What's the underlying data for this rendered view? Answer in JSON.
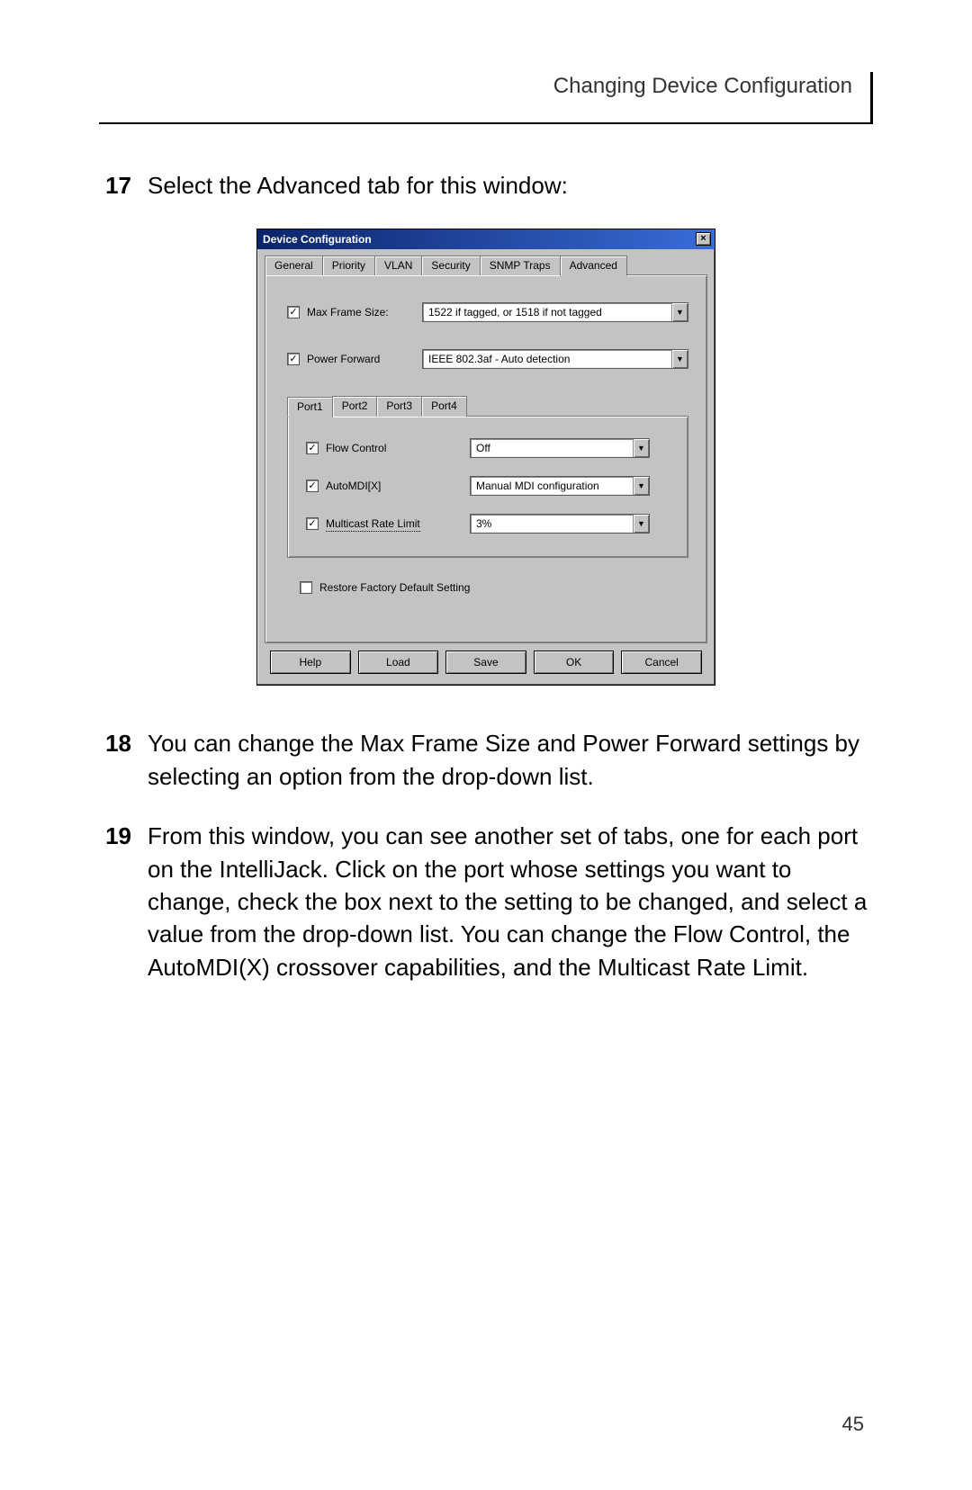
{
  "header": {
    "running_title": "Changing Device Configuration"
  },
  "steps": [
    {
      "num": "17",
      "text": "Select the Advanced tab for this window:"
    },
    {
      "num": "18",
      "text": "You can change the Max Frame Size and Power Forward settings by selecting an option from the drop-down list."
    },
    {
      "num": "19",
      "text": "From this window, you can see another set of tabs, one for each port on the IntelliJack. Click on the port whose settings you want to change, check the box next to the setting to be changed, and select a value from the drop-down list. You can change the Flow Control, the AutoMDI(X) crossover capabilities, and the Multicast Rate Limit."
    }
  ],
  "page_number": "45",
  "dialog": {
    "title": "Device Configuration",
    "close_label": "×",
    "tabs": [
      "General",
      "Priority",
      "VLAN",
      "Security",
      "SNMP Traps",
      "Advanced"
    ],
    "active_tab_index": 5,
    "fields": {
      "max_frame_size": {
        "checked": true,
        "label": "Max Frame Size:",
        "value": "1522 if tagged, or 1518 if not tagged"
      },
      "power_forward": {
        "checked": true,
        "label": "Power Forward",
        "value": "IEEE 802.3af - Auto detection"
      }
    },
    "port_tabs": [
      "Port1",
      "Port2",
      "Port3",
      "Port4"
    ],
    "port_active_index": 0,
    "port_fields": {
      "flow_control": {
        "checked": true,
        "label": "Flow Control",
        "value": "Off"
      },
      "automidx": {
        "checked": true,
        "label": "AutoMDI[X]",
        "value": "Manual MDI configuration"
      },
      "multicast": {
        "checked": true,
        "label": "Multicast Rate Limit",
        "value": "3%"
      }
    },
    "restore": {
      "checked": false,
      "label": "Restore Factory Default Setting"
    },
    "buttons": [
      "Help",
      "Load",
      "Save",
      "OK",
      "Cancel"
    ]
  }
}
